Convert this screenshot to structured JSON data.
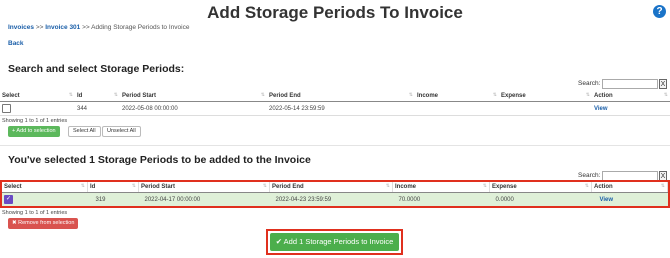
{
  "page": {
    "title": "Add Storage Periods To Invoice",
    "help_icon": "?",
    "breadcrumb": {
      "items": [
        "Invoices",
        "Invoice 301",
        "Adding Storage Periods to Invoice"
      ],
      "separator": ">>"
    },
    "back_label": "Back"
  },
  "search_section": {
    "heading": "Search and select Storage Periods:",
    "search_label": "Search:",
    "search_value": "",
    "clear_label": "X",
    "columns": [
      "Select",
      "Id",
      "Period Start",
      "Period End",
      "Income",
      "Expense",
      "Action"
    ],
    "rows": [
      {
        "checked": false,
        "id": "344",
        "period_start": "2022-05-08 00:00:00",
        "period_end": "2022-05-14 23:59:59",
        "income": "",
        "expense": "",
        "action": "View"
      }
    ],
    "info": "Showing 1 to 1 of 1 entries",
    "add_button": "+ Add to selection",
    "select_all": "Select All",
    "unselect_all": "Unselect All"
  },
  "selected_section": {
    "heading": "You've selected 1 Storage Periods to be added to the Invoice",
    "search_label": "Search:",
    "search_value": "",
    "clear_label": "X",
    "columns": [
      "Select",
      "Id",
      "Period Start",
      "Period End",
      "Income",
      "Expense",
      "Action"
    ],
    "rows": [
      {
        "checked": true,
        "id": "319",
        "period_start": "2022-04-17 00:00:00",
        "period_end": "2022-04-23 23:59:59",
        "income": "70.0000",
        "expense": "0.0000",
        "action": "View"
      }
    ],
    "info": "Showing 1 to 1 of 1 entries",
    "remove_button": "✖ Remove from selection"
  },
  "submit_button": "✔ Add 1 Storage Periods to Invoice",
  "colors": {
    "accent_green": "#5cb85c",
    "danger_red": "#d9534f",
    "highlight_frame": "#e0301e",
    "selected_row": "#dff0d8",
    "link": "#1a5ea8"
  }
}
